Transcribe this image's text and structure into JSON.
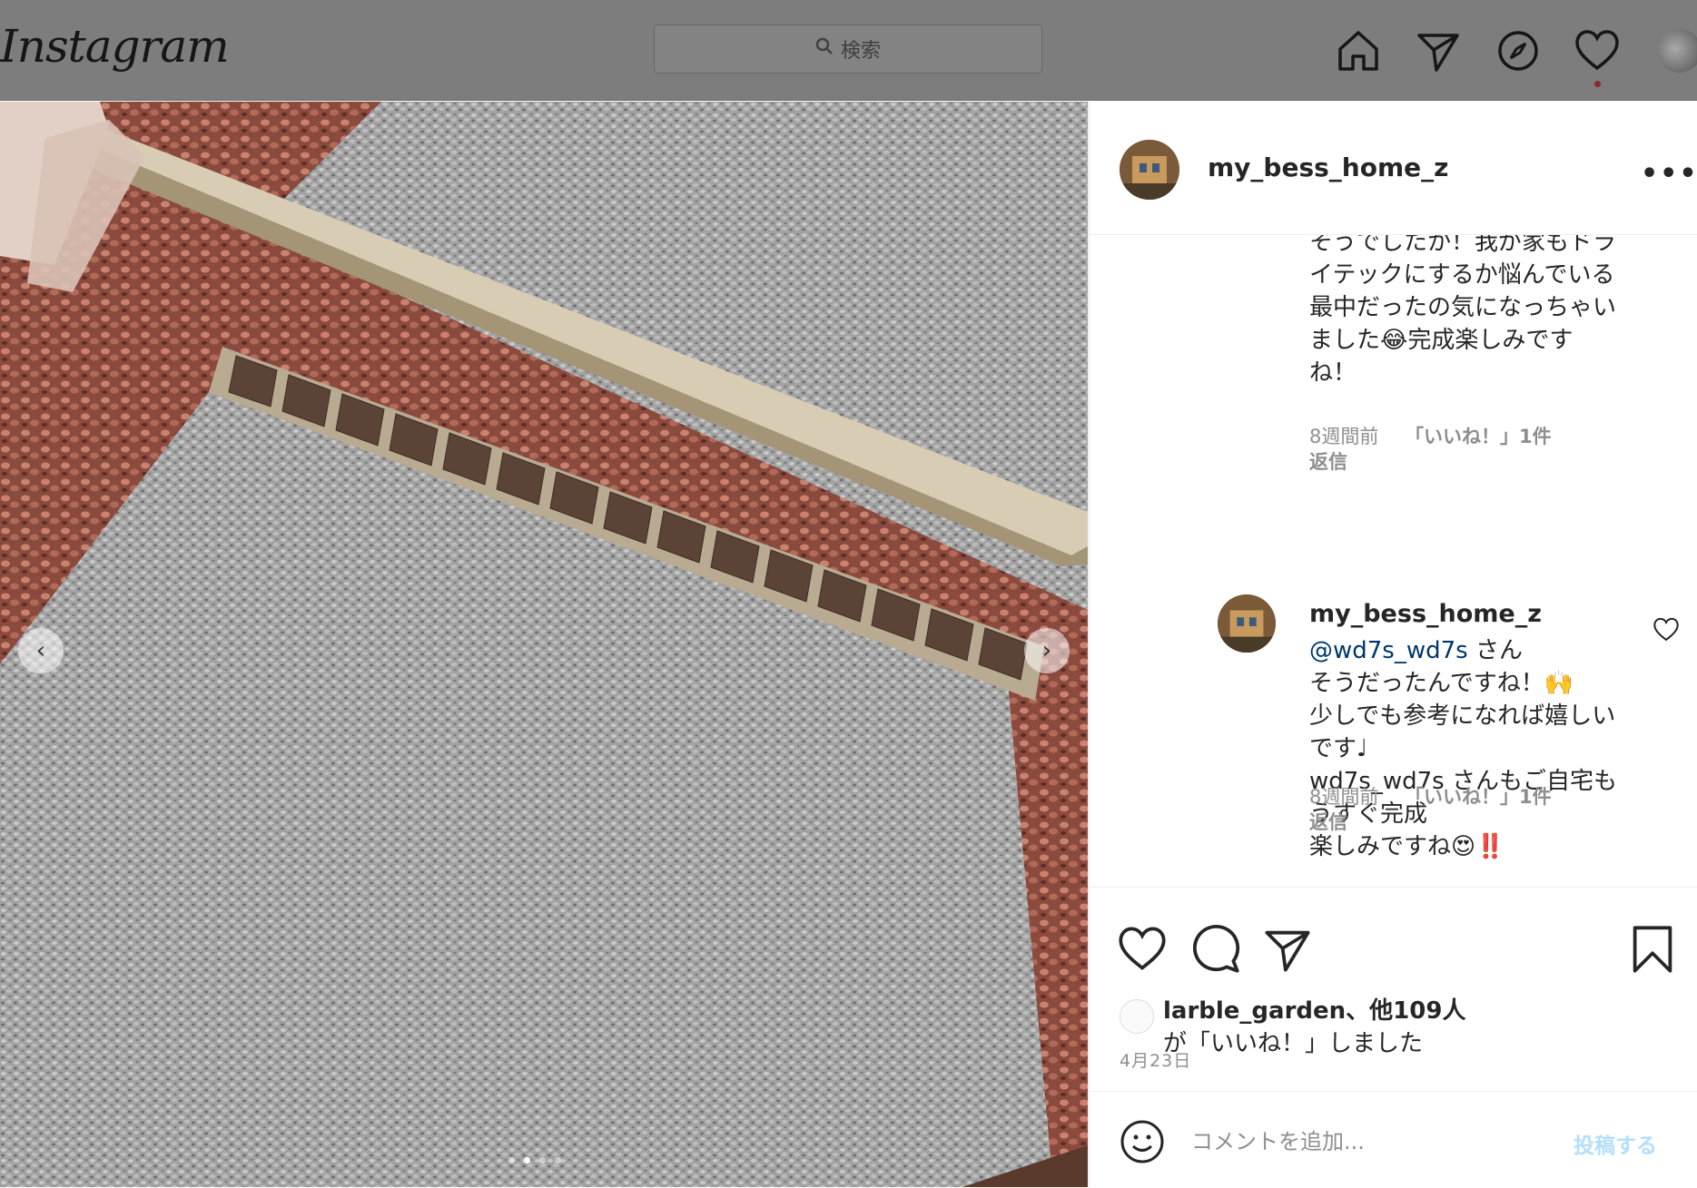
{
  "nav": {
    "logo": "Instagram",
    "search_placeholder": "検索",
    "icons": [
      "home-icon",
      "direct-icon",
      "explore-icon",
      "activity-icon",
      "profile-avatar"
    ]
  },
  "post": {
    "author": "my_bess_home_z",
    "more": "•••",
    "comments": [
      {
        "lines": [
          "そうでしたか！我が家もドラ",
          "イテックにするか悩んでいる",
          "最中だったの気になっちゃい",
          "ました😂完成楽しみです",
          "ね！"
        ],
        "time": "8週間前",
        "likes": "「いいね！」1件",
        "reply": "返信"
      },
      {
        "author": "my_bess_home_z",
        "mention": "@wd7s_wd7s",
        "mention_suffix": " さん",
        "lines": [
          "そうだったんですね！🙌",
          "少しでも参考になれば嬉しい",
          "です♩",
          "wd7s_wd7s さんもご自宅も",
          "うすぐ完成",
          "楽しみですね😍‼️"
        ],
        "time": "8週間前",
        "likes": "「いいね！」1件",
        "reply": "返信"
      }
    ],
    "liked_by": "larble_garden、他109人",
    "liked_suffix": "が「いいね！」しました",
    "date": "4月23日",
    "comment_placeholder": "コメントを追加...",
    "post_button": "投稿する"
  },
  "carousel": {
    "prev": "‹",
    "next": "›",
    "count": 4,
    "active": 2
  },
  "colors": {
    "link": "#00376b",
    "post_button_disabled": "#b2dffc",
    "nav_dim": "#7d7d7d"
  }
}
